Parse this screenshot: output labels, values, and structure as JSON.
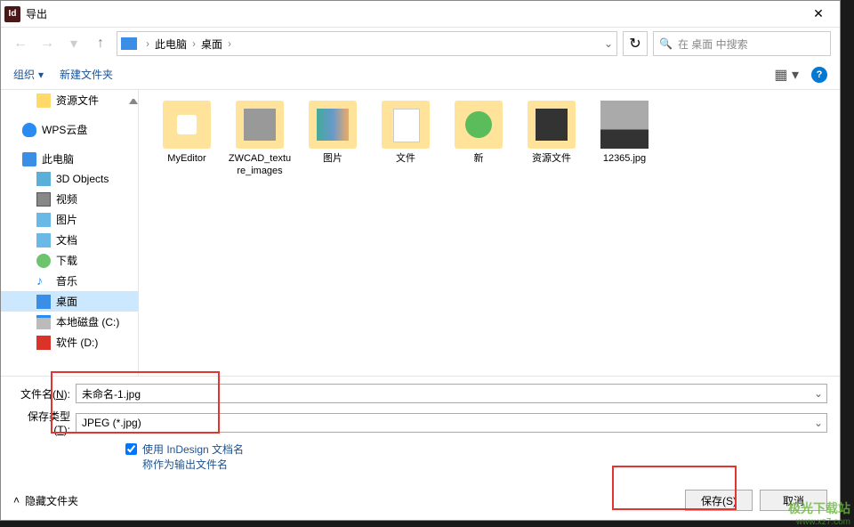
{
  "titlebar": {
    "app_icon_text": "Id",
    "title": "导出"
  },
  "breadcrumb": {
    "seg1": "此电脑",
    "seg2": "桌面"
  },
  "search": {
    "placeholder": "在 桌面 中搜索"
  },
  "toolbar": {
    "organize": "组织",
    "new_folder": "新建文件夹"
  },
  "sidebar": {
    "items": [
      {
        "label": "资源文件"
      },
      {
        "label": "WPS云盘"
      },
      {
        "label": "此电脑"
      },
      {
        "label": "3D Objects"
      },
      {
        "label": "视频"
      },
      {
        "label": "图片"
      },
      {
        "label": "文档"
      },
      {
        "label": "下载"
      },
      {
        "label": "音乐"
      },
      {
        "label": "桌面"
      },
      {
        "label": "本地磁盘 (C:)"
      },
      {
        "label": "软件 (D:)"
      }
    ]
  },
  "files": [
    {
      "label": "MyEditor",
      "cls": "f-myeditor"
    },
    {
      "label": "ZWCAD_texture_images",
      "cls": "f-zwcad"
    },
    {
      "label": "图片",
      "cls": "f-pics"
    },
    {
      "label": "文件",
      "cls": "f-files"
    },
    {
      "label": "新",
      "cls": "f-new"
    },
    {
      "label": "资源文件",
      "cls": "f-resources"
    },
    {
      "label": "12365.jpg",
      "cls": "f-image"
    }
  ],
  "form": {
    "filename_label_pre": "文件名(",
    "filename_label_key": "N",
    "filename_label_post": "):",
    "filename_value": "未命名-1.jpg",
    "filetype_label_pre": "保存类型(",
    "filetype_label_key": "T",
    "filetype_label_post": "):",
    "filetype_value": "JPEG (*.jpg)",
    "checkbox_label_l1": "使用 InDesign 文档名",
    "checkbox_label_l2": "称作为输出文件名"
  },
  "buttons": {
    "hide_folders": "隐藏文件夹",
    "save": "保存(S)",
    "cancel": "取消"
  },
  "watermark": {
    "big": "极光下载站",
    "small": "www.xz7.com"
  }
}
